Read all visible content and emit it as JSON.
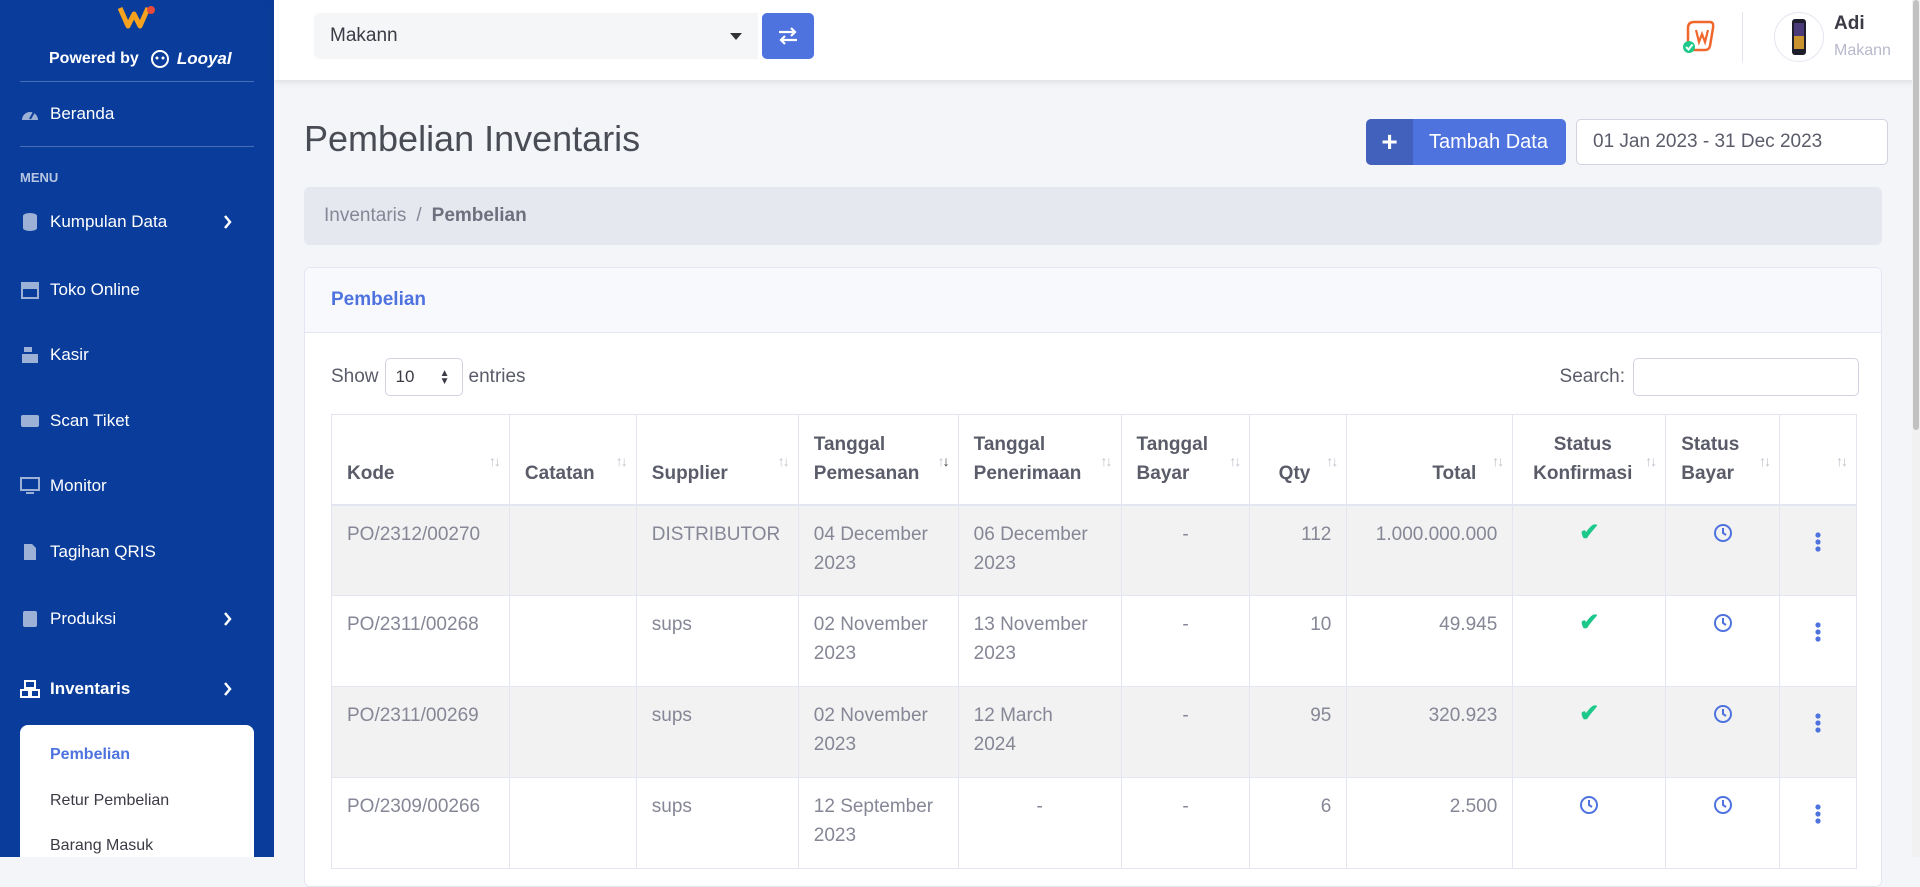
{
  "sidebar": {
    "powered_by": "Powered by",
    "partner": "Looyal",
    "home": "Beranda",
    "menu_heading": "MENU",
    "items": [
      {
        "label": "Kumpulan Data"
      },
      {
        "label": "Toko Online"
      },
      {
        "label": "Kasir"
      },
      {
        "label": "Scan Tiket"
      },
      {
        "label": "Monitor"
      },
      {
        "label": "Tagihan QRIS"
      },
      {
        "label": "Produksi"
      },
      {
        "label": "Inventaris"
      }
    ],
    "submenu": [
      "Pembelian",
      "Retur Pembelian",
      "Barang Masuk"
    ]
  },
  "topbar": {
    "store": "Makann",
    "user_name": "Adi",
    "user_store": "Makann"
  },
  "page": {
    "title": "Pembelian Inventaris",
    "add_label": "Tambah Data",
    "date_range": "01 Jan 2023 - 31 Dec 2023",
    "breadcrumb": {
      "parent": "Inventaris",
      "current": "Pembelian"
    }
  },
  "card": {
    "title": "Pembelian",
    "show_label": "Show",
    "entries_value": "10",
    "entries_label": "entries",
    "search_label": "Search:"
  },
  "table": {
    "headers": {
      "kode": "Kode",
      "catatan": "Catatan",
      "supplier": "Supplier",
      "tgl_pesan_1": "Tanggal",
      "tgl_pesan_2": "Pemesanan",
      "tgl_terima_1": "Tanggal",
      "tgl_terima_2": "Penerimaan",
      "tgl_bayar_1": "Tanggal",
      "tgl_bayar_2": "Bayar",
      "qty": "Qty",
      "total": "Total",
      "konf_1": "Status",
      "konf_2": "Konfirmasi",
      "bayar_1": "Status",
      "bayar_2": "Bayar"
    },
    "rows": [
      {
        "kode": "PO/2312/00270",
        "catatan": "",
        "supplier": "DISTRIBUTOR",
        "pesan_1": "04 December",
        "pesan_2": "2023",
        "terima_1": "06 December",
        "terima_2": "2023",
        "bayar": "-",
        "qty": "112",
        "total": "1.000.000.000",
        "konfirmasi": "confirmed",
        "status_bayar": "pending"
      },
      {
        "kode": "PO/2311/00268",
        "catatan": "",
        "supplier": "sups",
        "pesan_1": "02 November",
        "pesan_2": "2023",
        "terima_1": "13 November",
        "terima_2": "2023",
        "bayar": "-",
        "qty": "10",
        "total": "49.945",
        "konfirmasi": "confirmed",
        "status_bayar": "pending"
      },
      {
        "kode": "PO/2311/00269",
        "catatan": "",
        "supplier": "sups",
        "pesan_1": "02 November",
        "pesan_2": "2023",
        "terima_1": "12 March",
        "terima_2": "2024",
        "bayar": "-",
        "qty": "95",
        "total": "320.923",
        "konfirmasi": "confirmed",
        "status_bayar": "pending"
      },
      {
        "kode": "PO/2309/00266",
        "catatan": "",
        "supplier": "sups",
        "pesan_1": "12 September",
        "pesan_2": "2023",
        "terima_1": "-",
        "terima_2": "",
        "bayar": "-",
        "qty": "6",
        "total": "2.500",
        "konfirmasi": "pending",
        "status_bayar": "pending"
      }
    ]
  },
  "colors": {
    "sidebar": "#0a3d9b",
    "primary": "#4e73df",
    "success": "#1cc88a"
  },
  "icons": {
    "home": "dashboard-gauge-icon",
    "kumpulan_data": "database-icon",
    "toko_online": "store-icon",
    "kasir": "cash-register-icon",
    "scan_tiket": "ticket-icon",
    "monitor": "monitor-icon",
    "tagihan_qris": "file-invoice-icon",
    "produksi": "book-icon",
    "inventaris": "boxes-icon",
    "confirmed": "check-icon",
    "pending": "clock-icon",
    "actions": "kebab-menu-icon"
  }
}
